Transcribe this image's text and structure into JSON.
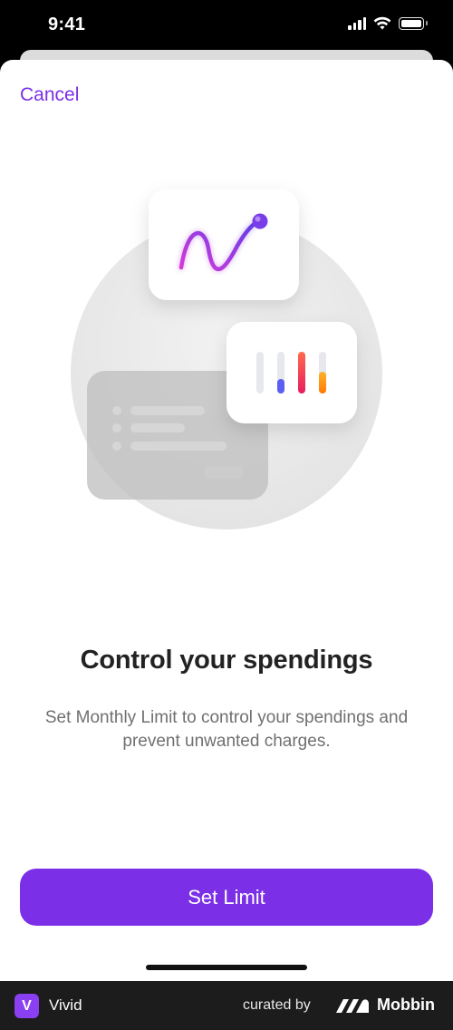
{
  "status_bar": {
    "time": "9:41"
  },
  "sheet": {
    "cancel_label": "Cancel"
  },
  "content": {
    "title": "Control your spendings",
    "subtitle": "Set Monthly Limit to control your spendings and prevent unwanted charges."
  },
  "cta": {
    "label": "Set Limit"
  },
  "footer": {
    "brand_letter": "V",
    "brand_name": "Vivid",
    "curated_by": "curated by",
    "mobbin_name": "Mobbin"
  },
  "colors": {
    "accent": "#7b2fe6",
    "text_primary": "#222222",
    "text_secondary": "#707070"
  }
}
